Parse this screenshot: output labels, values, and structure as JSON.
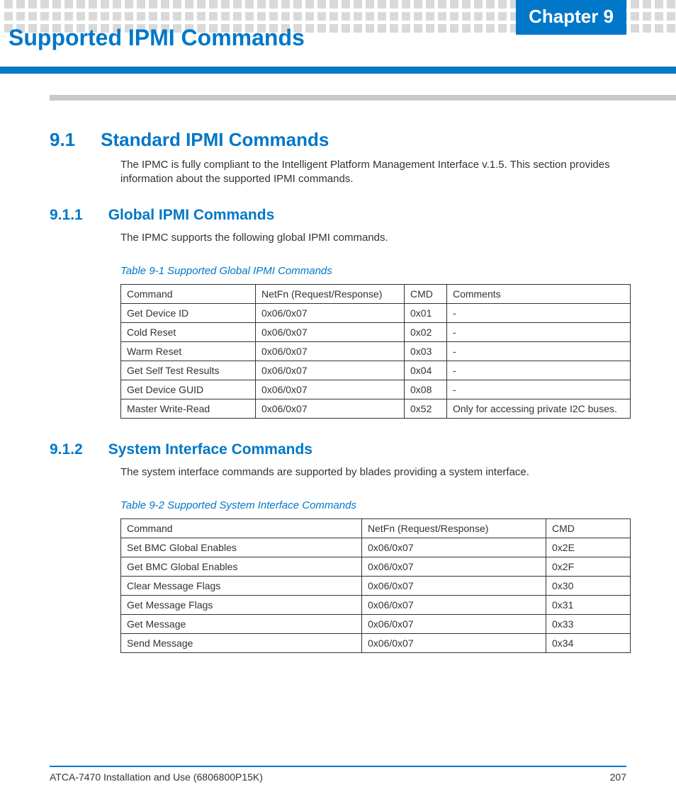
{
  "chapter_tab": "Chapter 9",
  "page_title": "Supported IPMI Commands",
  "section_9_1": {
    "num": "9.1",
    "title": "Standard IPMI Commands",
    "body": "The IPMC is fully compliant to the Intelligent Platform Management Interface v.1.5. This section provides information about the supported IPMI commands."
  },
  "section_9_1_1": {
    "num": "9.1.1",
    "title": "Global IPMI Commands",
    "body": "The IPMC supports the following global IPMI commands.",
    "table_caption": "Table 9-1 Supported Global IPMI Commands",
    "headers": [
      "Command",
      "NetFn (Request/Response)",
      "CMD",
      "Comments"
    ],
    "rows": [
      [
        "Get Device ID",
        "0x06/0x07",
        "0x01",
        "-"
      ],
      [
        "Cold Reset",
        "0x06/0x07",
        "0x02",
        "-"
      ],
      [
        "Warm Reset",
        "0x06/0x07",
        "0x03",
        "-"
      ],
      [
        "Get Self Test Results",
        "0x06/0x07",
        "0x04",
        "-"
      ],
      [
        "Get Device GUID",
        "0x06/0x07",
        "0x08",
        "-"
      ],
      [
        "Master Write-Read",
        "0x06/0x07",
        "0x52",
        "Only for accessing private I2C buses."
      ]
    ]
  },
  "section_9_1_2": {
    "num": "9.1.2",
    "title": "System Interface Commands",
    "body": "The system interface commands are supported by blades providing a system interface.",
    "table_caption": "Table 9-2 Supported System Interface Commands",
    "headers": [
      "Command",
      "NetFn (Request/Response)",
      "CMD"
    ],
    "rows": [
      [
        "Set BMC Global Enables",
        "0x06/0x07",
        "0x2E"
      ],
      [
        "Get BMC Global Enables",
        "0x06/0x07",
        "0x2F"
      ],
      [
        "Clear Message Flags",
        "0x06/0x07",
        "0x30"
      ],
      [
        "Get Message Flags",
        "0x06/0x07",
        "0x31"
      ],
      [
        "Get Message",
        "0x06/0x07",
        "0x33"
      ],
      [
        "Send Message",
        "0x06/0x07",
        "0x34"
      ]
    ]
  },
  "footer": {
    "left": "ATCA-7470 Installation and Use (6806800P15K)",
    "right": "207"
  }
}
